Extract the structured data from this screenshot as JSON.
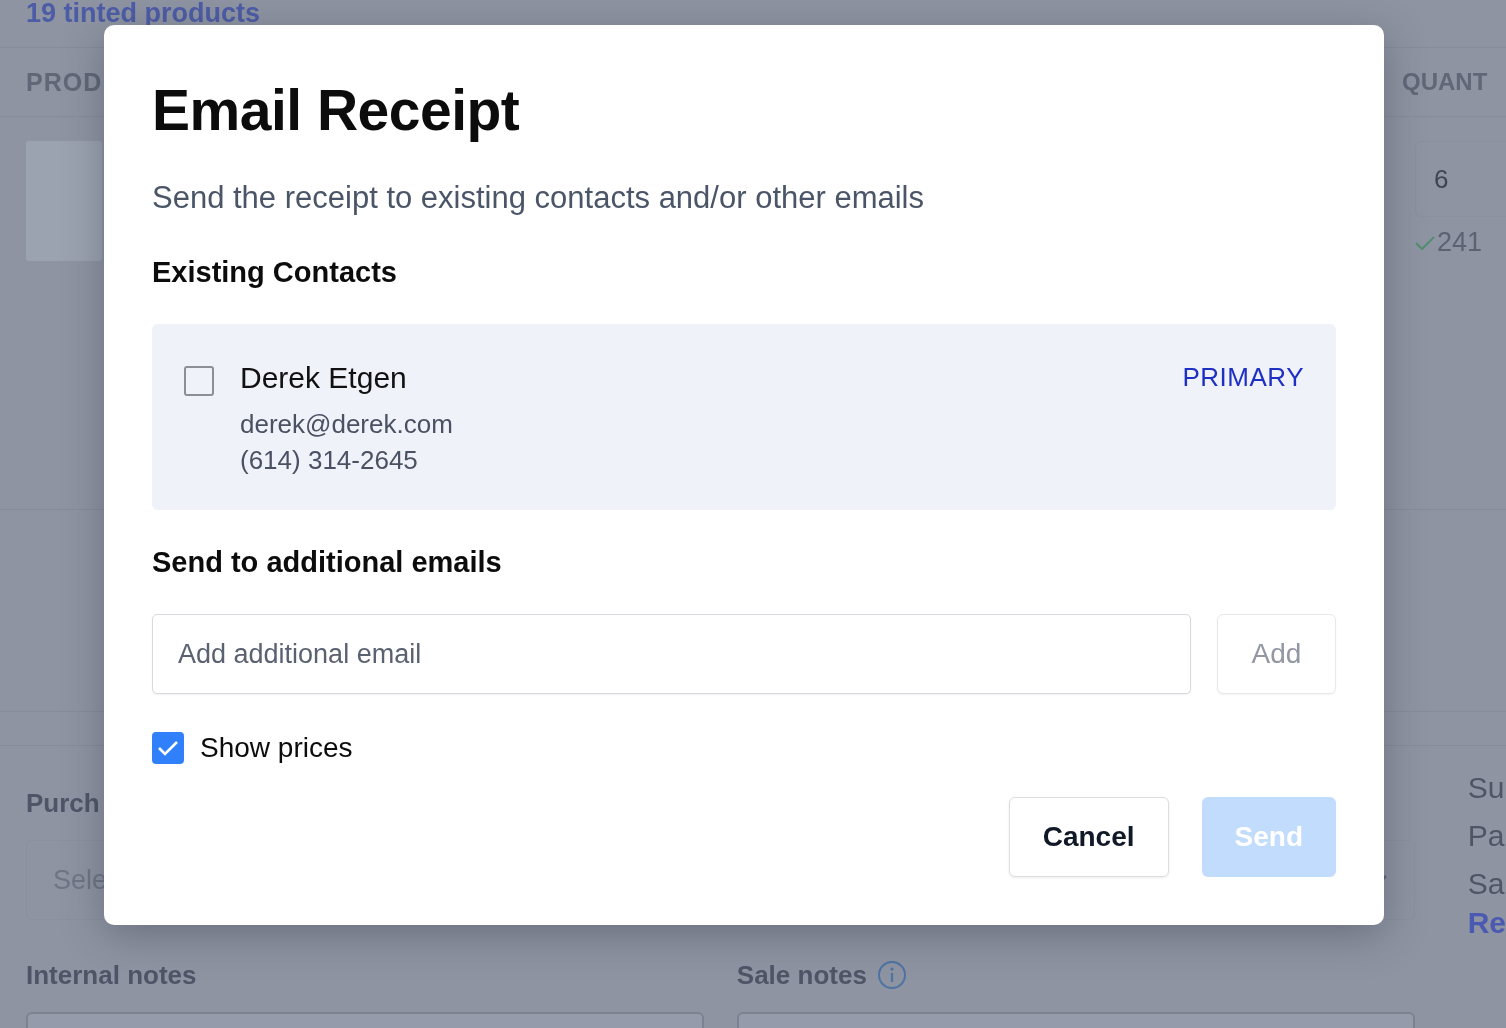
{
  "background": {
    "title": "19 tinted products",
    "columns": [
      "PROD",
      "QUANT"
    ],
    "product": {
      "quantity": "6",
      "stock": "241"
    },
    "purchase_label": "Purch",
    "purchase_select": {
      "placeholder": "Sele"
    },
    "internal_notes_label": "Internal notes",
    "sale_notes_label": "Sale notes",
    "summary_lines": [
      "Su",
      "Pa",
      "Sa"
    ],
    "summary_link": "Re"
  },
  "dialog": {
    "title": "Email Receipt",
    "subtitle": "Send the receipt to existing contacts and/or other emails",
    "contacts_heading": "Existing Contacts",
    "contacts": [
      {
        "name": "Derek Etgen",
        "email": "derek@derek.com",
        "phone": "(614) 314-2645",
        "badge": "PRIMARY",
        "checked": false
      }
    ],
    "additional_heading": "Send to additional emails",
    "email_field": {
      "placeholder": "Add additional email"
    },
    "add_button": {
      "label": "Add",
      "disabled": true
    },
    "show_prices": {
      "label": "Show prices",
      "checked": true
    },
    "buttons": [
      {
        "label": "Cancel",
        "kind": "secondary",
        "disabled": false
      },
      {
        "label": "Send",
        "kind": "primary",
        "disabled": true
      }
    ]
  }
}
